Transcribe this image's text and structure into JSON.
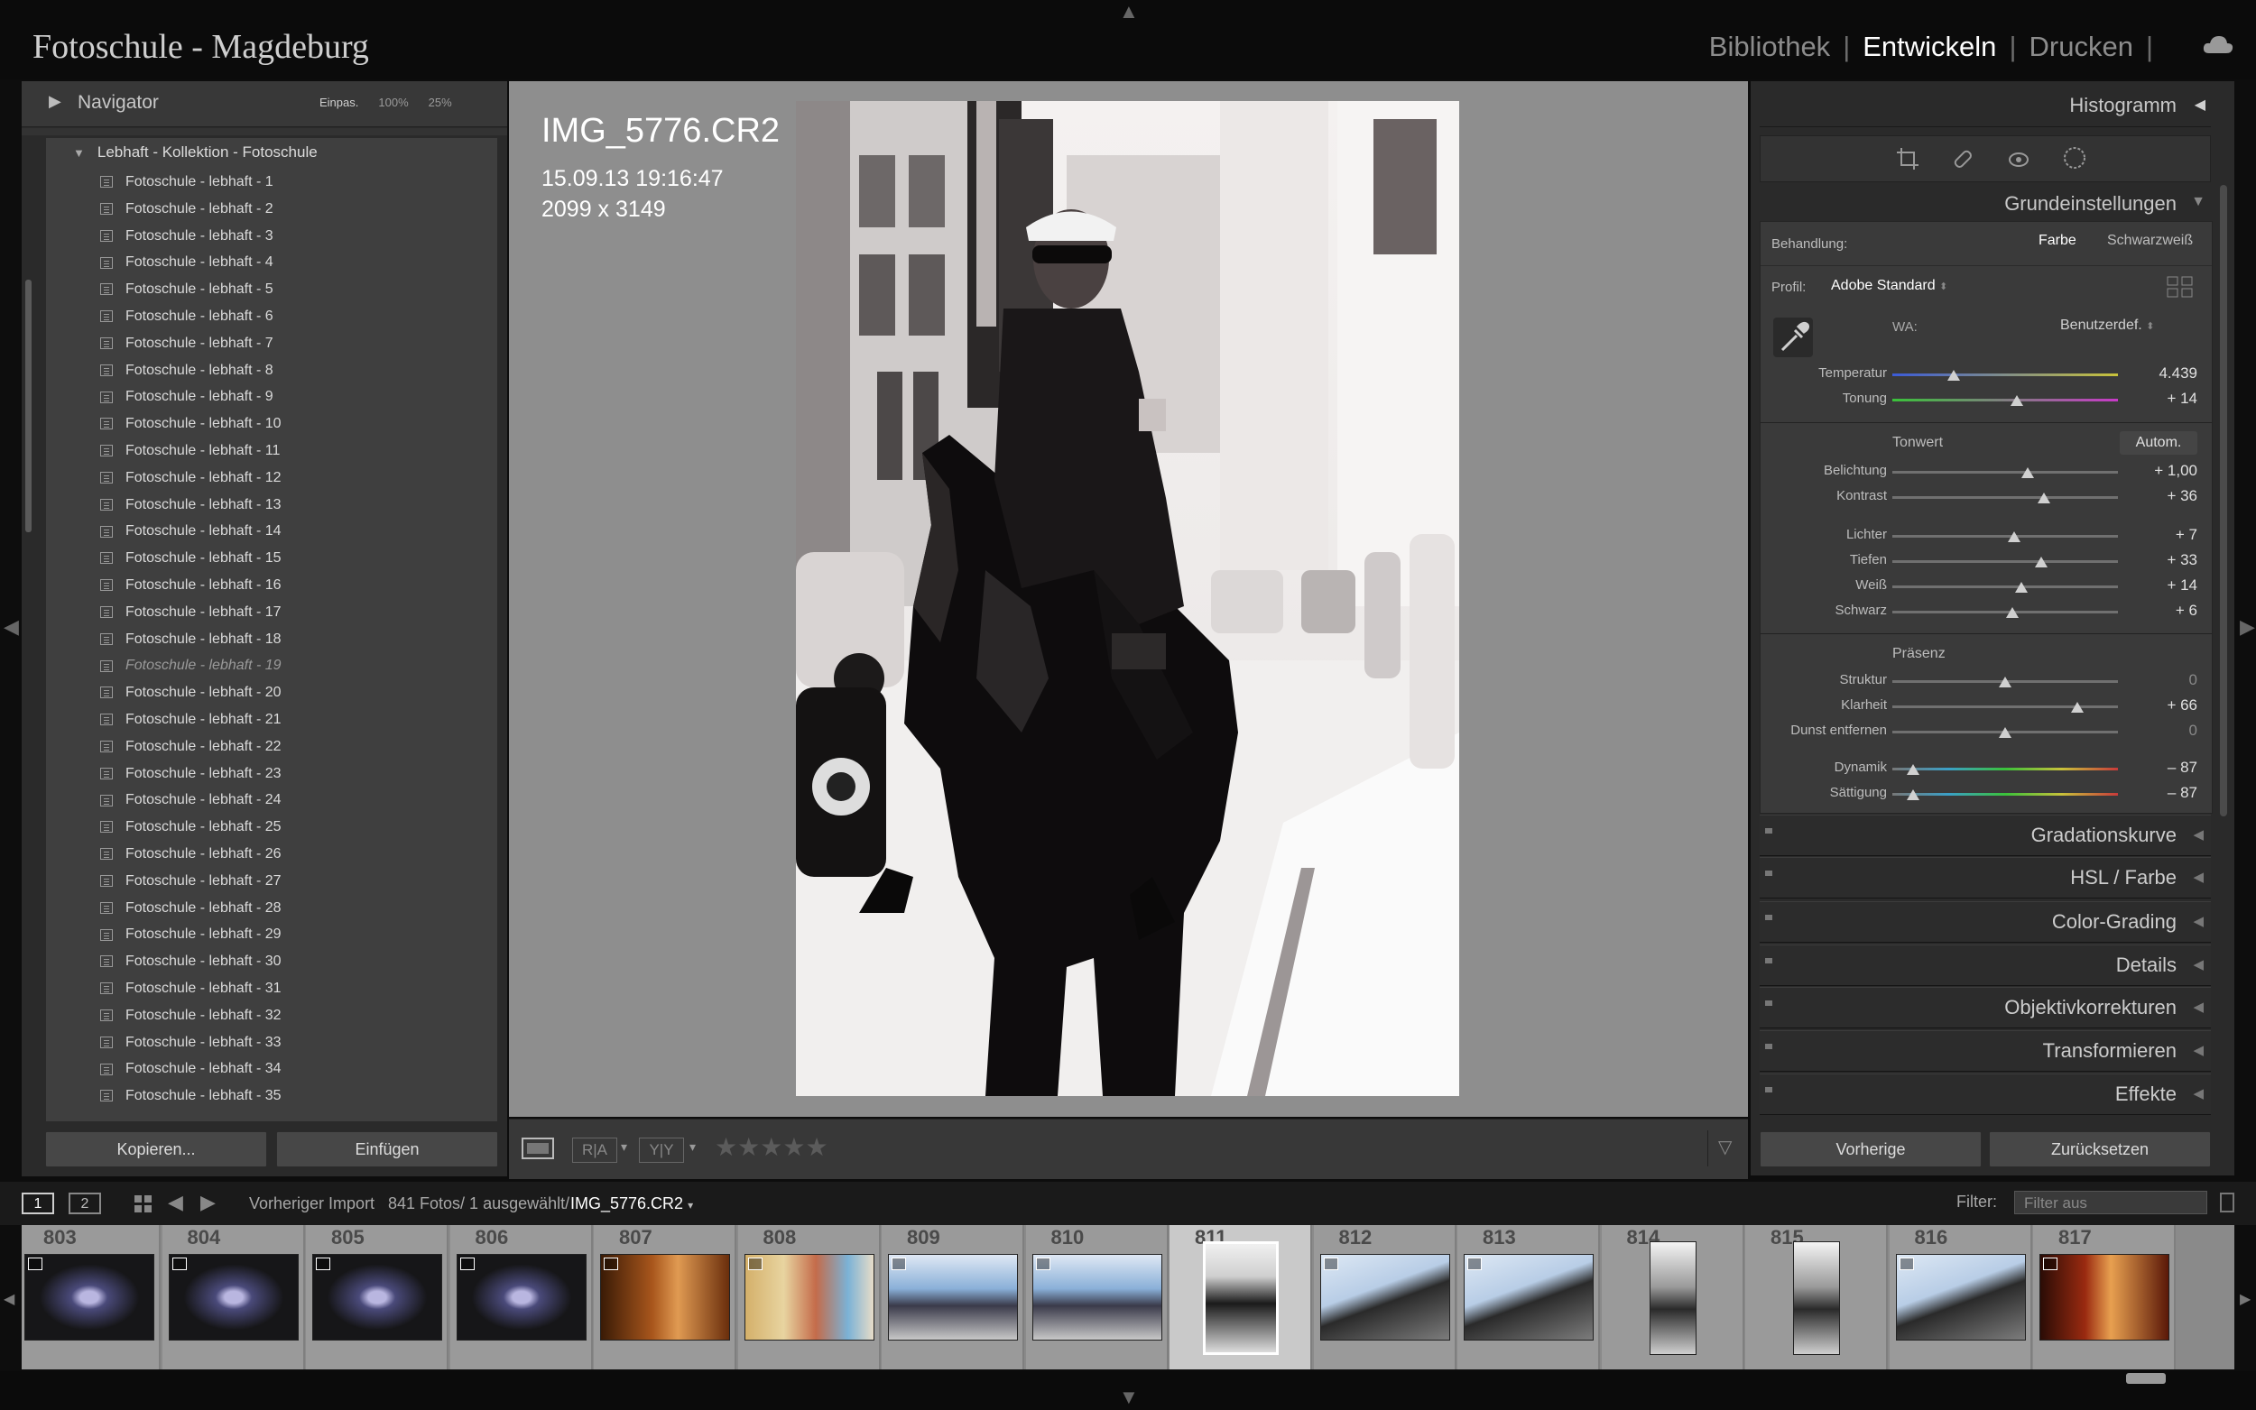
{
  "app": {
    "title": "Fotoschule - Magdeburg"
  },
  "modules": {
    "library": "Bibliothek",
    "develop": "Entwickeln",
    "print": "Drucken",
    "separator": "|"
  },
  "navigator": {
    "title": "Navigator",
    "zoom_fit": "Einpas.",
    "zoom_100": "100%",
    "zoom_25": "25%"
  },
  "collection": {
    "name": "Lebhaft - Kollektion - Fotoschule",
    "items": [
      "Fotoschule - lebhaft - 1",
      "Fotoschule - lebhaft - 2",
      "Fotoschule - lebhaft - 3",
      "Fotoschule - lebhaft - 4",
      "Fotoschule - lebhaft - 5",
      "Fotoschule - lebhaft - 6",
      "Fotoschule - lebhaft - 7",
      "Fotoschule - lebhaft - 8",
      "Fotoschule - lebhaft - 9",
      "Fotoschule - lebhaft - 10",
      "Fotoschule - lebhaft - 11",
      "Fotoschule - lebhaft - 12",
      "Fotoschule - lebhaft - 13",
      "Fotoschule - lebhaft - 14",
      "Fotoschule - lebhaft - 15",
      "Fotoschule - lebhaft - 16",
      "Fotoschule - lebhaft - 17",
      "Fotoschule - lebhaft - 18",
      "Fotoschule - lebhaft - 19",
      "Fotoschule - lebhaft - 20",
      "Fotoschule - lebhaft - 21",
      "Fotoschule - lebhaft - 22",
      "Fotoschule - lebhaft - 23",
      "Fotoschule - lebhaft - 24",
      "Fotoschule - lebhaft - 25",
      "Fotoschule - lebhaft - 26",
      "Fotoschule - lebhaft - 27",
      "Fotoschule - lebhaft - 28",
      "Fotoschule - lebhaft - 29",
      "Fotoschule - lebhaft - 30",
      "Fotoschule - lebhaft - 31",
      "Fotoschule - lebhaft - 32",
      "Fotoschule - lebhaft - 33",
      "Fotoschule - lebhaft - 34",
      "Fotoschule - lebhaft - 35"
    ]
  },
  "left_buttons": {
    "copy": "Kopieren...",
    "paste": "Einfügen"
  },
  "photo": {
    "filename": "IMG_5776.CR2",
    "date": "15.09.13 19:16:47",
    "dimensions": "2099 x 3149"
  },
  "toolbar": {
    "before_after": "R|A",
    "ab": "Y|Y"
  },
  "right": {
    "histogram": "Histogramm",
    "basic": "Grundeinstellungen",
    "treatment_label": "Behandlung:",
    "treatment_color": "Farbe",
    "treatment_bw": "Schwarzweiß",
    "profile_label": "Profil:",
    "profile_value": "Adobe Standard",
    "wb_label": "WA:",
    "wb_value": "Benutzerdef.",
    "tone_label": "Tonwert",
    "auto_label": "Autom.",
    "presence_label": "Präsenz",
    "sliders": [
      {
        "label": "Temperatur",
        "value": "4.439",
        "pos": 0.27,
        "kind": "temp"
      },
      {
        "label": "Tonung",
        "value": "+ 14",
        "pos": 0.55,
        "kind": "tint"
      },
      {
        "label": "Belichtung",
        "value": "+ 1,00",
        "pos": 0.6,
        "kind": "plain"
      },
      {
        "label": "Kontrast",
        "value": "+ 36",
        "pos": 0.67,
        "kind": "plain"
      },
      {
        "label": "Lichter",
        "value": "+ 7",
        "pos": 0.54,
        "kind": "plain"
      },
      {
        "label": "Tiefen",
        "value": "+ 33",
        "pos": 0.66,
        "kind": "plain"
      },
      {
        "label": "Weiß",
        "value": "+ 14",
        "pos": 0.57,
        "kind": "plain"
      },
      {
        "label": "Schwarz",
        "value": "+ 6",
        "pos": 0.53,
        "kind": "plain"
      },
      {
        "label": "Struktur",
        "value": "0",
        "pos": 0.5,
        "kind": "plain"
      },
      {
        "label": "Klarheit",
        "value": "+ 66",
        "pos": 0.82,
        "kind": "plain"
      },
      {
        "label": "Dunst entfernen",
        "value": "0",
        "pos": 0.5,
        "kind": "plain"
      },
      {
        "label": "Dynamik",
        "value": "– 87",
        "pos": 0.09,
        "kind": "color"
      },
      {
        "label": "Sättigung",
        "value": "– 87",
        "pos": 0.09,
        "kind": "color"
      }
    ],
    "panels": [
      "Gradationskurve",
      "HSL / Farbe",
      "Color-Grading",
      "Details",
      "Objektivkorrekturen",
      "Transformieren",
      "Effekte"
    ],
    "prev_button": "Vorherige",
    "reset_button": "Zurücksetzen"
  },
  "strip": {
    "page1": "1",
    "page2": "2",
    "source": "Vorheriger Import",
    "count": "841 Fotos/ 1 ausgewählt/",
    "current": "IMG_5776.CR2",
    "filter_label": "Filter:",
    "filter_value": "Filter aus"
  },
  "film": [
    {
      "num": "803",
      "kind": "night"
    },
    {
      "num": "804",
      "kind": "night"
    },
    {
      "num": "805",
      "kind": "night"
    },
    {
      "num": "806",
      "kind": "night"
    },
    {
      "num": "807",
      "kind": "warm"
    },
    {
      "num": "808",
      "kind": "crowd"
    },
    {
      "num": "809",
      "kind": "street"
    },
    {
      "num": "810",
      "kind": "street"
    },
    {
      "num": "811",
      "kind": "bw"
    },
    {
      "num": "812",
      "kind": "flat"
    },
    {
      "num": "813",
      "kind": "flat"
    },
    {
      "num": "814",
      "kind": "tall"
    },
    {
      "num": "815",
      "kind": "tall"
    },
    {
      "num": "816",
      "kind": "flat"
    },
    {
      "num": "817",
      "kind": "restaurant"
    }
  ]
}
